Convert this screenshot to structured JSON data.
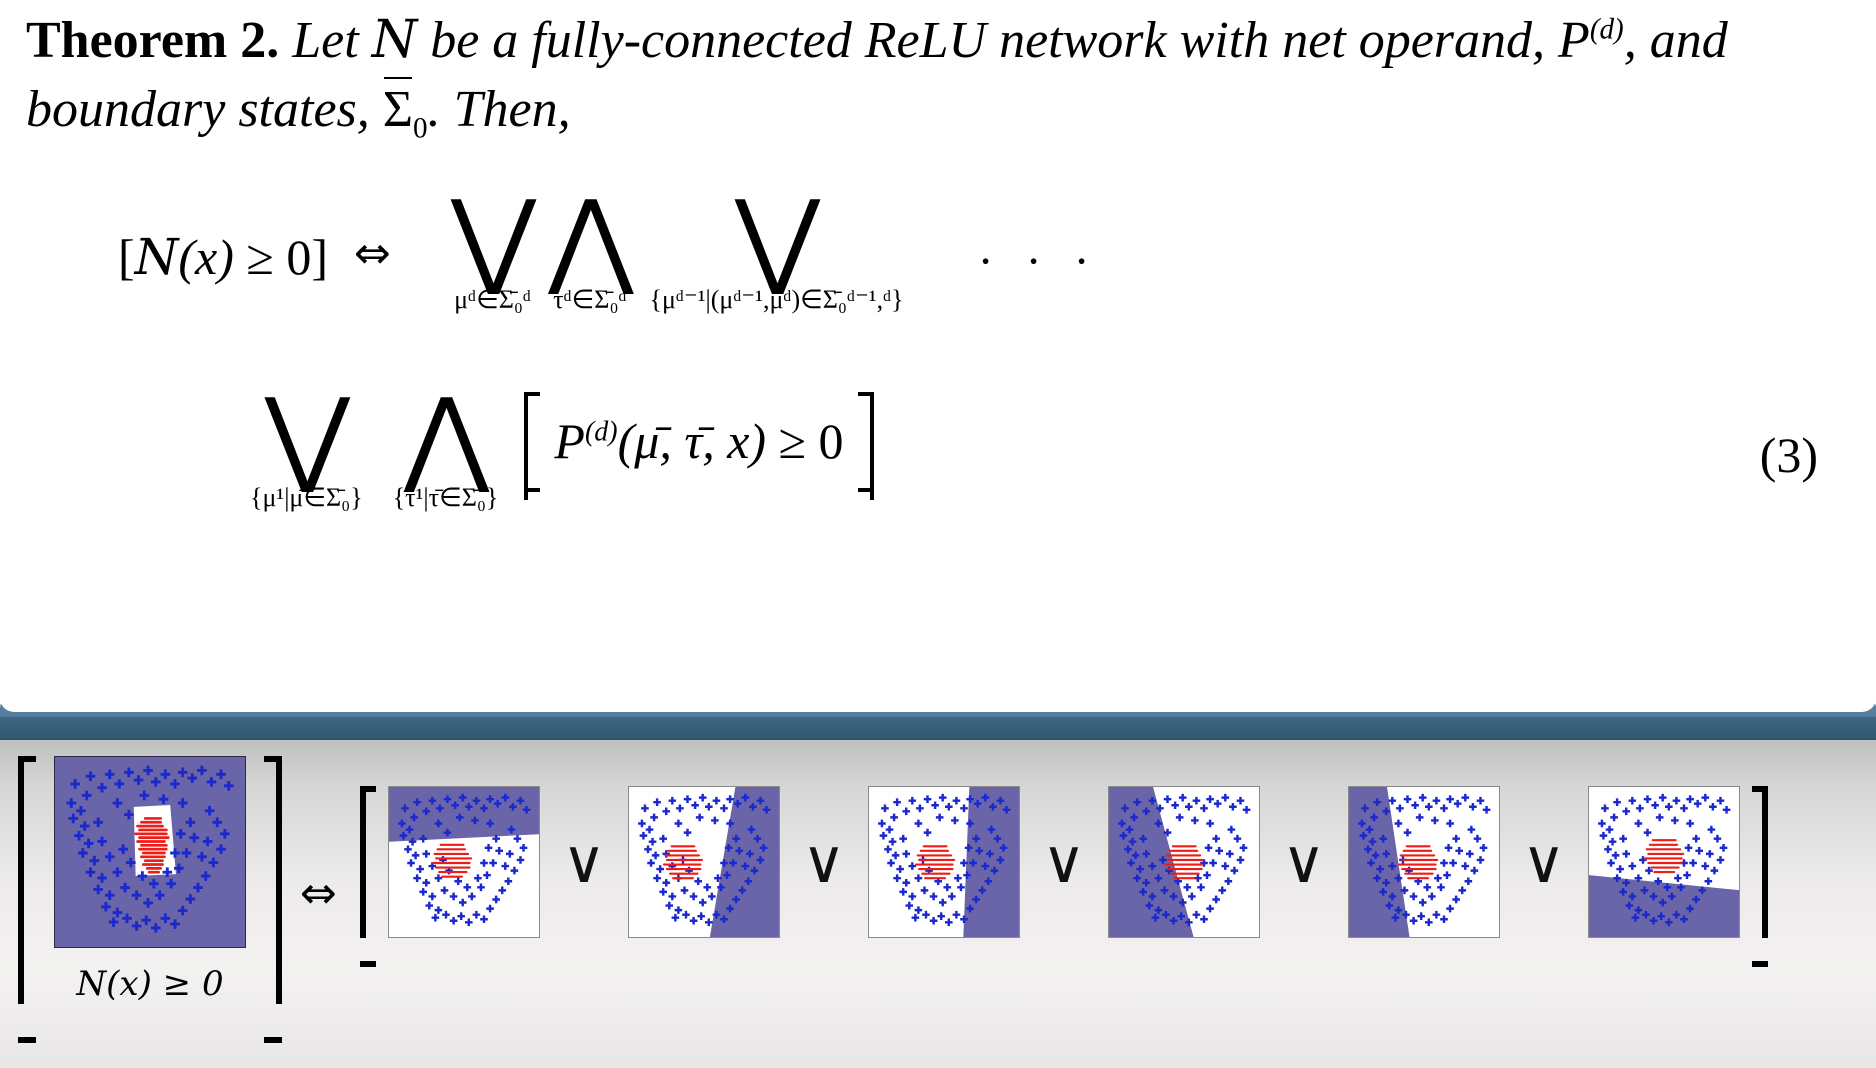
{
  "slide": {
    "theorem_label": "Theorem 2.",
    "statement_part1": "Let",
    "statement_N": "N",
    "statement_part2": "be a fully-connected ReLU network with net operand,",
    "statement_P": "P",
    "statement_P_sup": "(d)",
    "statement_part3": ", and boundary states,",
    "statement_Sigma": "Σ",
    "statement_Sigma_sub": "0",
    "statement_part4": ". Then,"
  },
  "equation": {
    "number": "(3)",
    "lhs": "[N(x) ≥ 0]",
    "lhs_bracket_open": "[",
    "lhs_N": "N",
    "lhs_paren_x": "(x)",
    "lhs_geq_zero": "≥ 0",
    "lhs_bracket_close": "]",
    "iff": "⇔",
    "ellipsis": "· · ·",
    "or_glyph": "⋁",
    "and_glyph": "⋀",
    "limits": {
      "or1": "μᵈ∈Σ̄₀ᵈ",
      "and1": "τᵈ∈Σ̄₀ᵈ",
      "or2": "{μᵈ⁻¹|(μᵈ⁻¹,μᵈ)∈Σ̄₀ᵈ⁻¹,ᵈ}",
      "or3": "{μ¹|μ̄∈Σ̄₀}",
      "and2": "{τ¹|τ̄∈Σ̄₀}"
    },
    "predicate": {
      "P": "P",
      "P_sup": "(d)",
      "args": "(μ̄, τ̄, x)",
      "geq": "≥ 0"
    }
  },
  "figure": {
    "left_caption": "N(x) ≥ 0",
    "iff_symbol": "⇔",
    "or_symbol": "∨",
    "colors": {
      "region_purple": "#6a64a8",
      "scatter_blue": "#1a28cc",
      "scatter_red": "#ee1c16",
      "panel_bg": "#ffffff",
      "panel_border": "#8a8a8a",
      "slide_bar_teal": "#4a7190",
      "strip_bg": "#ededec"
    },
    "panels": [
      {
        "id": "panel-main",
        "region": "v-notch",
        "label": "main"
      },
      {
        "id": "panel-1",
        "region": "top-band"
      },
      {
        "id": "panel-2",
        "region": "right-slab-a"
      },
      {
        "id": "panel-3",
        "region": "right-slab-b"
      },
      {
        "id": "panel-4",
        "region": "left-slab-a"
      },
      {
        "id": "panel-5",
        "region": "left-slab-b"
      },
      {
        "id": "panel-6",
        "region": "bottom-band"
      }
    ]
  }
}
